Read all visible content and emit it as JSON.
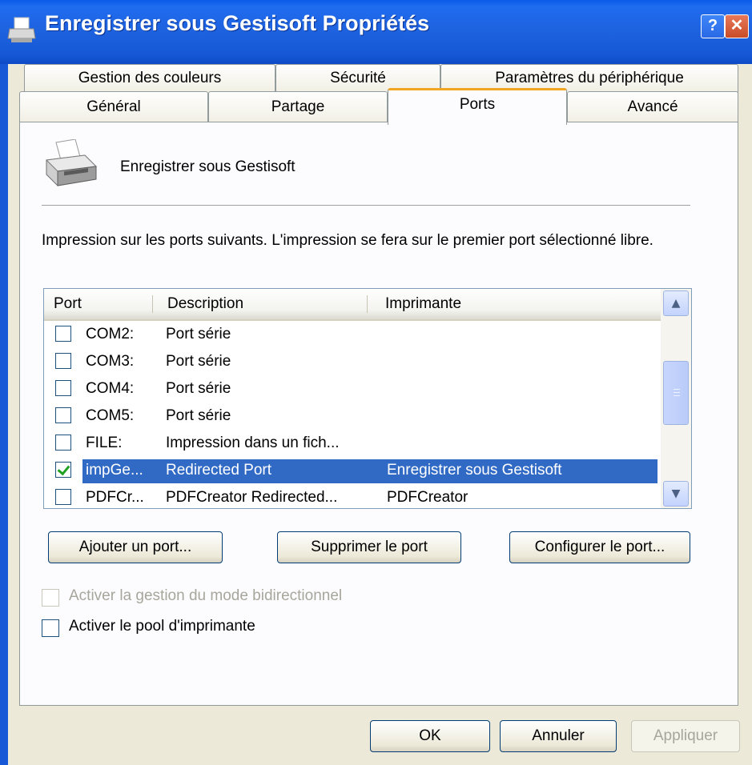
{
  "window": {
    "title": "Enregistrer sous Gestisoft Propriétés",
    "help_button": "?",
    "close_button": "✕"
  },
  "tabs": {
    "row1": [
      "Gestion des couleurs",
      "Sécurité",
      "Paramètres du périphérique"
    ],
    "row2": [
      "Général",
      "Partage",
      "Ports",
      "Avancé"
    ],
    "active": "Ports"
  },
  "printer": {
    "name": "Enregistrer sous Gestisoft"
  },
  "description": "Impression sur les ports suivants. L'impression se fera sur le premier port sélectionné libre.",
  "port_list": {
    "columns": [
      "Port",
      "Description",
      "Imprimante"
    ],
    "rows": [
      {
        "checked": false,
        "port": "COM2:",
        "description": "Port série",
        "printer": "",
        "selected": false
      },
      {
        "checked": false,
        "port": "COM3:",
        "description": "Port série",
        "printer": "",
        "selected": false
      },
      {
        "checked": false,
        "port": "COM4:",
        "description": "Port série",
        "printer": "",
        "selected": false
      },
      {
        "checked": false,
        "port": "COM5:",
        "description": "Port série",
        "printer": "",
        "selected": false
      },
      {
        "checked": false,
        "port": "FILE:",
        "description": "Impression dans un fich...",
        "printer": "",
        "selected": false
      },
      {
        "checked": true,
        "port": "impGe...",
        "description": "Redirected Port",
        "printer": "Enregistrer sous Gestisoft",
        "selected": true
      },
      {
        "checked": false,
        "port": "PDFCr...",
        "description": "PDFCreator Redirected...",
        "printer": "PDFCreator",
        "selected": false
      }
    ]
  },
  "port_buttons": {
    "add": "Ajouter un port...",
    "delete": "Supprimer le port",
    "configure": "Configurer le port..."
  },
  "options": {
    "bidirectional": {
      "label": "Activer la gestion du mode bidirectionnel",
      "checked": false,
      "enabled": false
    },
    "pooling": {
      "label": "Activer le pool d'imprimante",
      "checked": false,
      "enabled": true
    }
  },
  "footer": {
    "ok": "OK",
    "cancel": "Annuler",
    "apply": "Appliquer"
  },
  "colors": {
    "titlebar": "#1658d6",
    "selection": "#316ac5",
    "active_tab_accent": "#f0a623"
  }
}
